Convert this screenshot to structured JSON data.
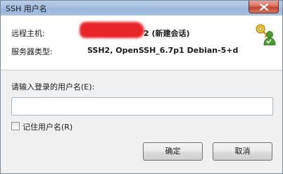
{
  "window": {
    "title": "SSH 用户名",
    "close_icon": "close-icon"
  },
  "info": {
    "remote_host_label": "远程主机:",
    "remote_host_value": "2 (新建会话)",
    "server_type_label": "服务器类型:",
    "server_type_value": "SSH2, OpenSSH_6.7p1 Debian-5+d",
    "icon": "keys-user-icon"
  },
  "form": {
    "prompt_label": "请输入登录的用户名(E):",
    "username_value": "",
    "remember_label": "记住用户名(R)",
    "remember_checked": false
  },
  "buttons": {
    "ok_label": "确定",
    "cancel_label": "取消"
  },
  "colors": {
    "redaction": "#e8262a",
    "titlebar": "#a8c2e3",
    "close_button": "#c2432e"
  }
}
